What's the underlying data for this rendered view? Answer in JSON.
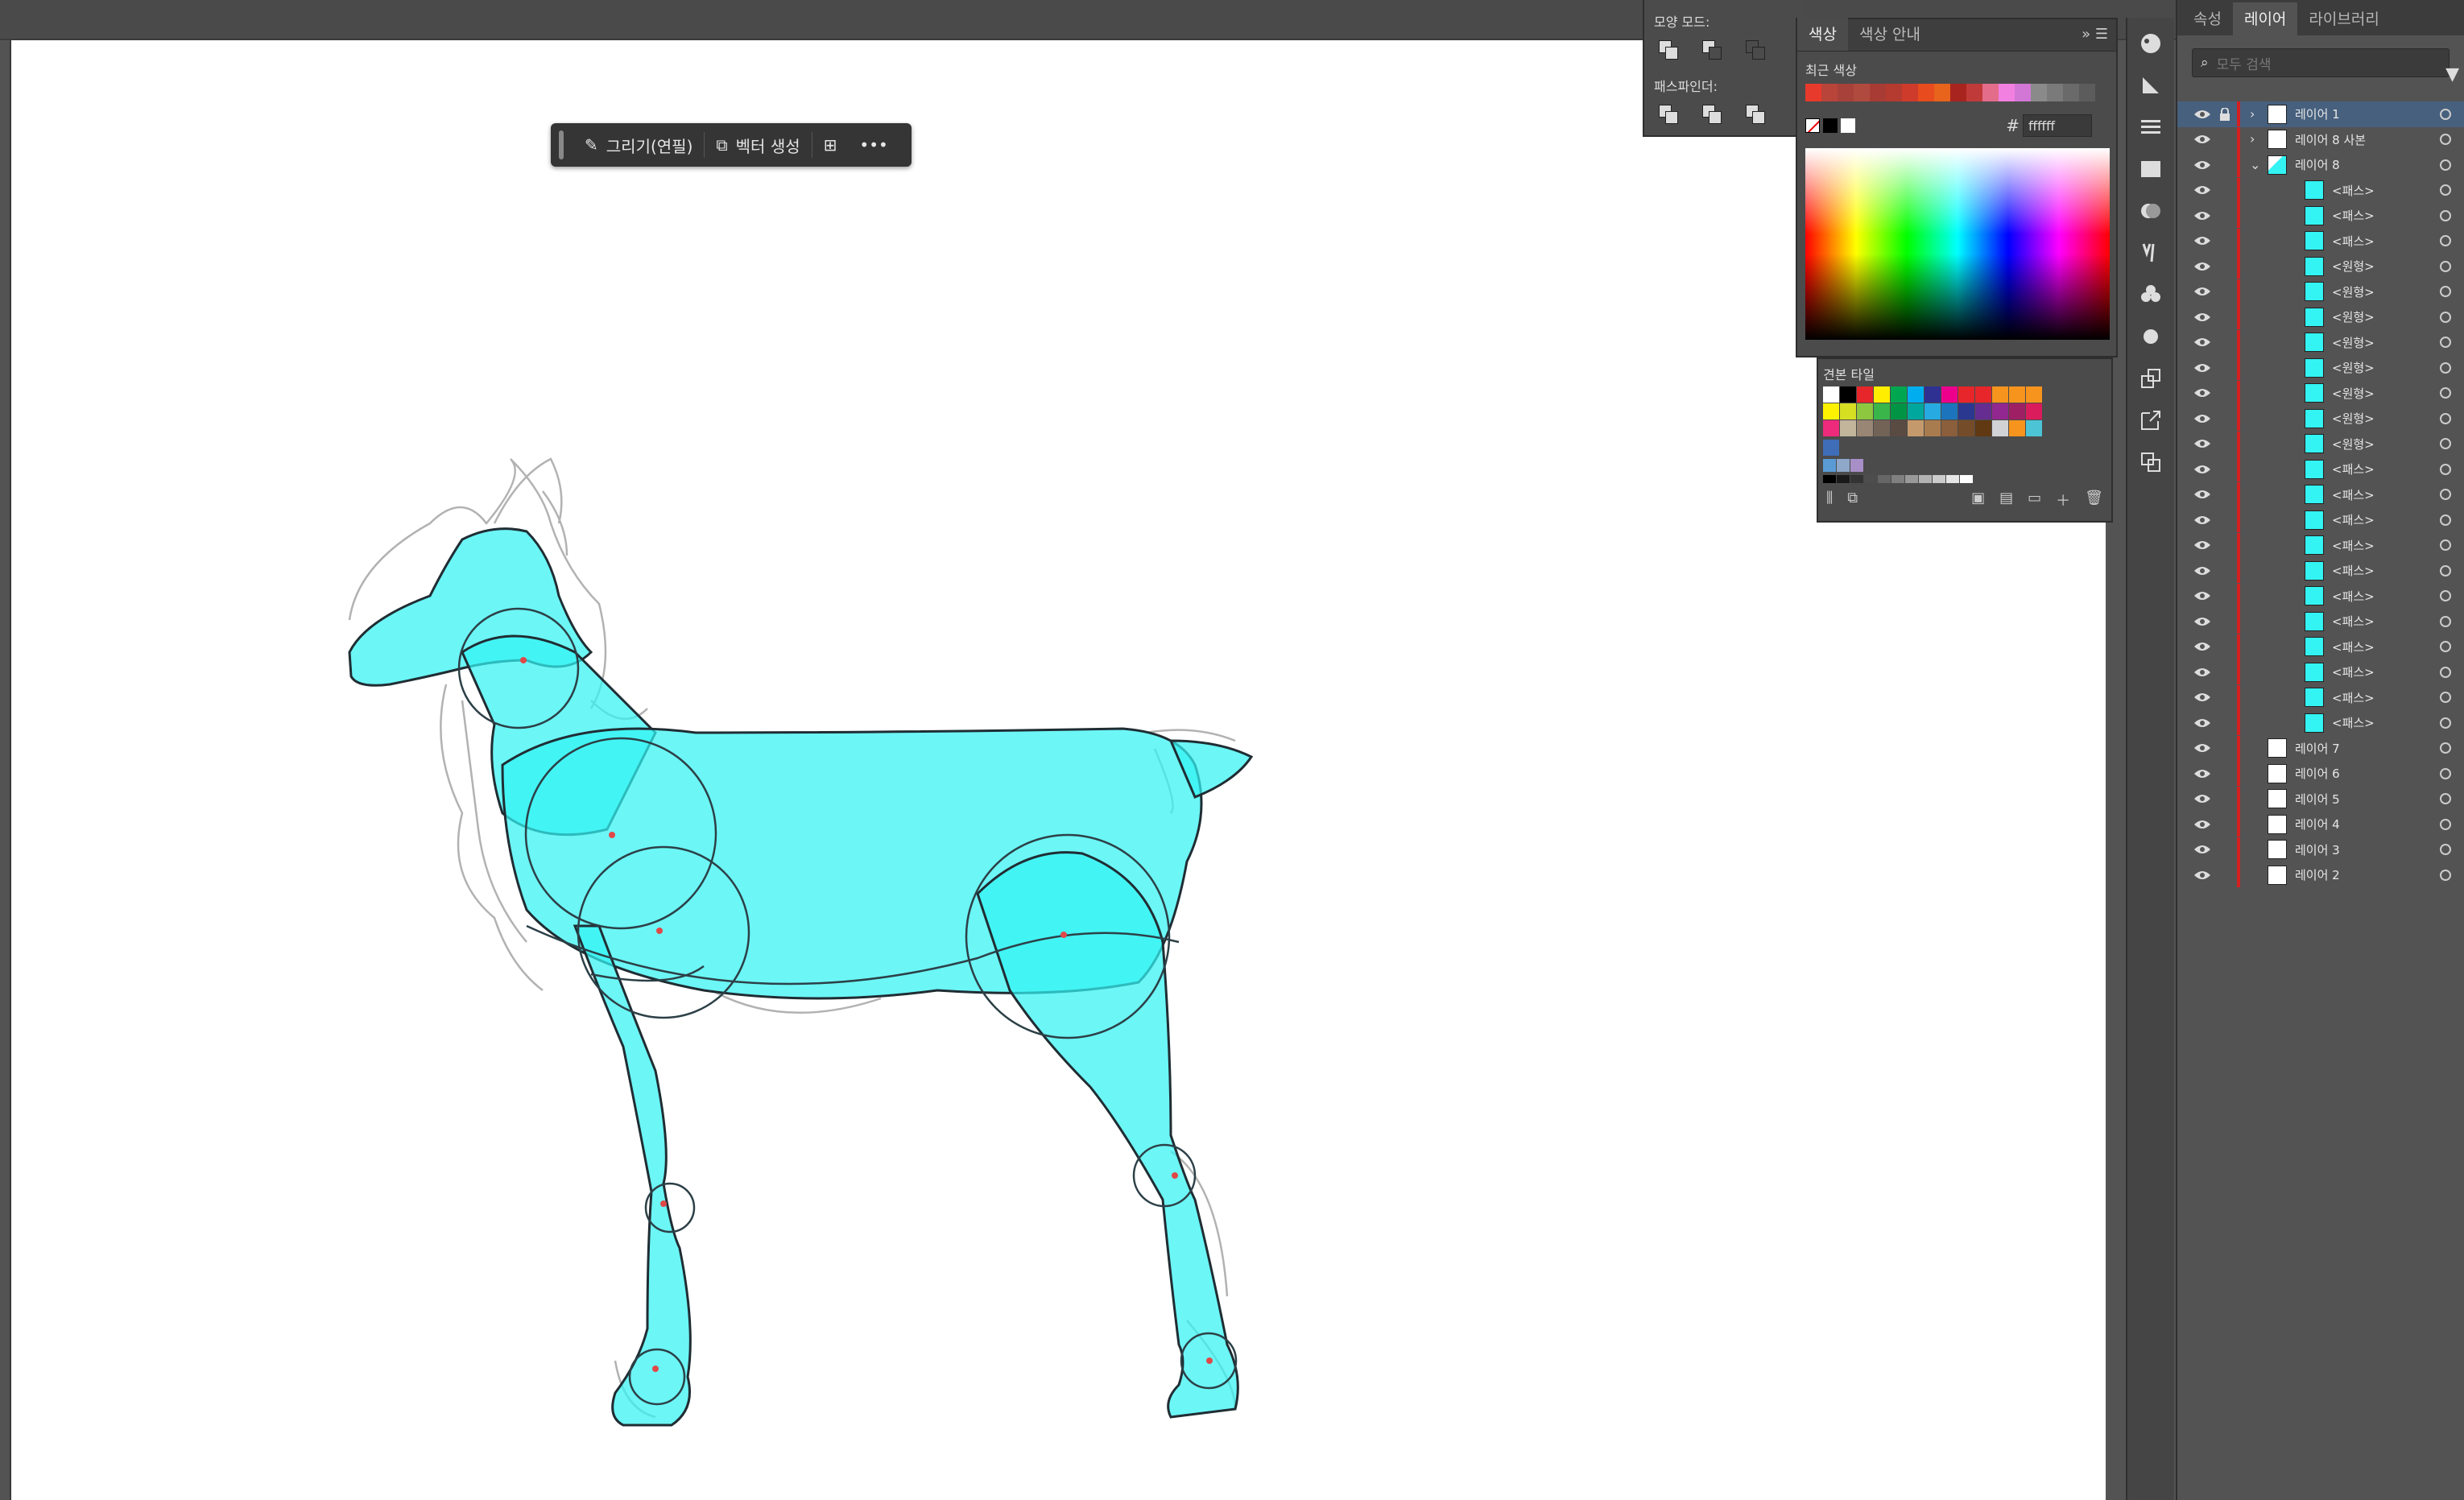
{
  "toolbar": {
    "draw_label": "그리기(연필)",
    "vector_label": "벡터 생성"
  },
  "shape_mode": {
    "label": "모양 모드:",
    "pathfinder_label": "패스파인더:"
  },
  "color_panel": {
    "tab_color": "색상",
    "tab_guide": "색상 안내",
    "recent_label": "최근 색상",
    "hex_prefix": "#",
    "hex_value": "ffffff",
    "recent_colors": [
      "#e83a2c",
      "#b8443a",
      "#a8413a",
      "#b04a3e",
      "#a83c34",
      "#b53a30",
      "#cf3b2b",
      "#e84c1e",
      "#e8631c",
      "#a8241e",
      "#c13a3a",
      "#e36c8a",
      "#f280e0",
      "#d277d6",
      "#8a8a8a",
      "#7a7a7a",
      "#6a6a6a",
      "#5c5c5c"
    ]
  },
  "swatch_panel": {
    "title": "견본 타일",
    "row1": [
      "#ffffff",
      "#000000",
      "#e6262a",
      "#ffee00",
      "#00a650",
      "#00aeef",
      "#2e3192",
      "#ec008c",
      "#e6262a",
      "#e6262a",
      "#f7941d",
      "#f7941d",
      "#f7941d"
    ],
    "row2": [
      "#fff200",
      "#d7df23",
      "#8dc63f",
      "#39b54a",
      "#009444",
      "#00a79d",
      "#27aae1",
      "#1c75bc",
      "#2b388f",
      "#662d91",
      "#92278f",
      "#9e1f63",
      "#da1c5c"
    ],
    "row3": [
      "#ed2a7b",
      "#c2b59b",
      "#998675",
      "#736357",
      "#594a42",
      "#c49a6c",
      "#a97c50",
      "#8b5e3c",
      "#754c29",
      "#603913",
      "#d1d3d4",
      "#f7941d",
      "#4dc4d6"
    ],
    "group1": [
      "#5b9bd5",
      "#8fa7c8",
      "#a88fc8"
    ],
    "gray_row": [
      "#000000",
      "#1a1a1a",
      "#333333",
      "#4d4d4d",
      "#666666",
      "#808080",
      "#999999",
      "#b3b3b3",
      "#cccccc",
      "#e6e6e6",
      "#ffffff"
    ]
  },
  "layers_panel": {
    "tabs": [
      "속성",
      "레이어",
      "라이브러리"
    ],
    "active_tab": "레이어",
    "search_placeholder": "모두 검색",
    "layers": [
      {
        "name": "레이어 1",
        "type": "layer",
        "selected": true,
        "expanded": false
      },
      {
        "name": "레이어 8 사본",
        "type": "layer",
        "expanded": false
      },
      {
        "name": "레이어 8",
        "type": "layer",
        "expanded": true
      },
      {
        "name": "<패스>",
        "type": "child"
      },
      {
        "name": "<패스>",
        "type": "child"
      },
      {
        "name": "<패스>",
        "type": "child"
      },
      {
        "name": "<원형>",
        "type": "child"
      },
      {
        "name": "<원형>",
        "type": "child"
      },
      {
        "name": "<원형>",
        "type": "child"
      },
      {
        "name": "<원형>",
        "type": "child"
      },
      {
        "name": "<원형>",
        "type": "child"
      },
      {
        "name": "<원형>",
        "type": "child"
      },
      {
        "name": "<원형>",
        "type": "child"
      },
      {
        "name": "<원형>",
        "type": "child"
      },
      {
        "name": "<패스>",
        "type": "child"
      },
      {
        "name": "<패스>",
        "type": "child"
      },
      {
        "name": "<패스>",
        "type": "child"
      },
      {
        "name": "<패스>",
        "type": "child"
      },
      {
        "name": "<패스>",
        "type": "child"
      },
      {
        "name": "<패스>",
        "type": "child"
      },
      {
        "name": "<패스>",
        "type": "child"
      },
      {
        "name": "<패스>",
        "type": "child"
      },
      {
        "name": "<패스>",
        "type": "child"
      },
      {
        "name": "<패스>",
        "type": "child"
      },
      {
        "name": "<패스>",
        "type": "child"
      },
      {
        "name": "레이어 7",
        "type": "layer"
      },
      {
        "name": "레이어 6",
        "type": "layer"
      },
      {
        "name": "레이어 5",
        "type": "layer"
      },
      {
        "name": "레이어 4",
        "type": "layer"
      },
      {
        "name": "레이어 3",
        "type": "layer"
      },
      {
        "name": "레이어 2",
        "type": "layer"
      }
    ]
  },
  "colors": {
    "accent_fill": "#33f3f3",
    "layer_color": "#d42020",
    "selection": "#46607e"
  }
}
